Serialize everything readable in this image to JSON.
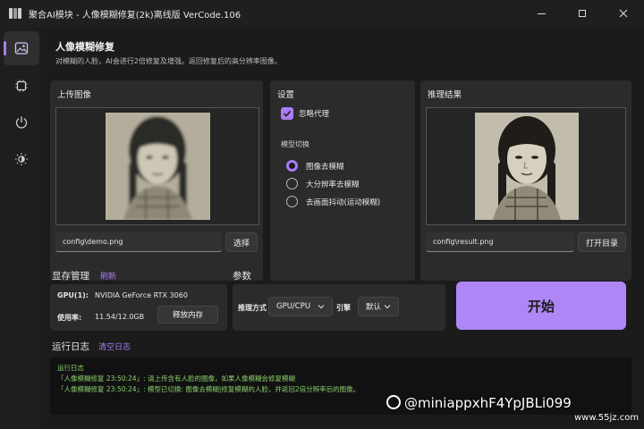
{
  "window": {
    "title": "聚合AI模块 - 人像模糊修复(2k)离线版 VerCode.106",
    "minimize_icon": "minimize-icon",
    "maximize_icon": "maximize-icon",
    "close_icon": "close-icon"
  },
  "sidebar": {
    "items": [
      {
        "icon": "image-restore-icon",
        "active": true
      },
      {
        "icon": "chip-icon",
        "active": false
      },
      {
        "icon": "power-icon",
        "active": false
      },
      {
        "icon": "theme-brightness-icon",
        "active": false
      }
    ]
  },
  "header": {
    "title": "人像模糊修复",
    "description": "对模糊的人脸，AI会进行2倍修复及增强。返回修复后的高分辨率图像。"
  },
  "upload": {
    "title": "上传图像",
    "path": "config\\demo.png",
    "select_label": "选择"
  },
  "settings": {
    "title": "设置",
    "ignore_proxy_label": "忽略代理",
    "ignore_proxy_checked": true,
    "model_switch_label": "模型切换",
    "models": [
      {
        "label": "图像去模糊",
        "selected": true
      },
      {
        "label": "大分辨率去模糊",
        "selected": false
      },
      {
        "label": "去画面抖动(运动模糊)",
        "selected": false
      }
    ]
  },
  "result": {
    "title": "推理结果",
    "path": "config\\result.png",
    "open_dir_label": "打开目录"
  },
  "vram": {
    "title": "显存管理",
    "refresh_label": "刷新",
    "gpu_label": "GPU(1):",
    "gpu_value": "NVIDIA GeForce RTX 3060",
    "usage_label": "使用率:",
    "usage_value": "11.54/12.0GB",
    "release_label": "释放内存"
  },
  "params": {
    "title": "参数",
    "inference_label": "推理方式",
    "inference_value": "GPU/CPU",
    "engine_label": "引擎",
    "engine_value": "默认"
  },
  "start": {
    "label": "开始"
  },
  "log": {
    "title": "运行日志",
    "clear_label": "清空日志",
    "lines": [
      "运行日志",
      "「人像模糊修复 23:50:24」: 请上传含有人脸的图像，如果人像模糊会修复模糊",
      "「人像模糊修复 23:50:24」: 模型已切换: 图像去模糊|修复模糊的人脸，并返回2倍分辨率后的图像。"
    ]
  },
  "watermark": {
    "main": "@miniappxhF4YpJBLi099",
    "site": "www.55jz.com"
  },
  "colors": {
    "accent": "#a97cf5",
    "start_button": "#ae86f5",
    "log_text": "#8ccf6e",
    "background": "#1b1b1b",
    "panel": "#2b2b2b"
  }
}
